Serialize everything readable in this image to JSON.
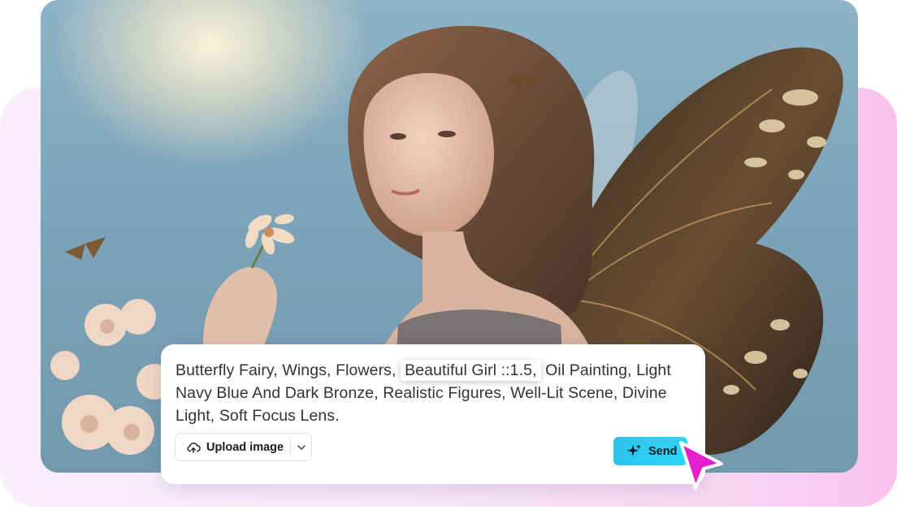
{
  "hero": {
    "subject": "butterfly-fairy-painting"
  },
  "prompt": {
    "before": "Butterfly Fairy, Wings, Flowers,",
    "highlight": "Beautiful Girl ::1.5,",
    "after": "Oil Painting, Light Navy Blue And Dark Bronze, Realistic Figures, Well-Lit Scene, Divine Light, Soft Focus Lens."
  },
  "upload": {
    "label": "Upload image",
    "icon": "cloud-upload-icon",
    "dropdown_icon": "chevron-down-icon"
  },
  "send": {
    "label": "Send",
    "icon": "sparkle-icon"
  },
  "cursor": {
    "icon": "cursor-pointer-icon"
  },
  "colors": {
    "accent": "#2ec2f0",
    "cursor": "#e81fcf",
    "text": "#333333"
  }
}
